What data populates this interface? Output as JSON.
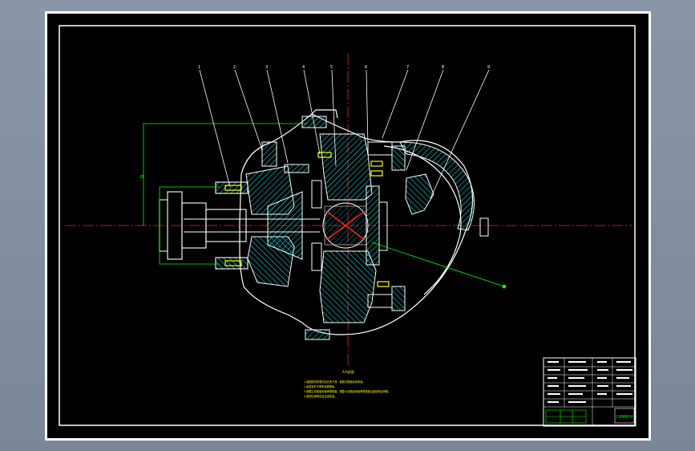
{
  "drawing": {
    "section_label": "A-A剖面",
    "notes": [
      "1.装配前所有零件应清洗干净，各配合表面涂润滑油。",
      "2.各密封件不得有渗漏现象。",
      "3.调整主动锥齿轮轴承预紧度，调整从动锥齿轮轴承预紧度及齿轮啮合间隙。",
      "4.装配后按规定加注齿轮油。"
    ],
    "callouts": [
      "1",
      "2",
      "3",
      "4",
      "5",
      "6",
      "7",
      "8",
      "9"
    ],
    "dimension_label": "Ø",
    "colors": {
      "sheet": "#000000",
      "frame": "#ffffff",
      "part_outline": "#ffffff",
      "hatch": "#00ffff",
      "dimension": "#00ff00",
      "centerline": "#ff0000",
      "fasteners": "#ffff00",
      "notes": "#ffff00"
    }
  },
  "title_block": {
    "drawing_name": "主减速器总成"
  },
  "window": {
    "background": "#8a96a8"
  }
}
